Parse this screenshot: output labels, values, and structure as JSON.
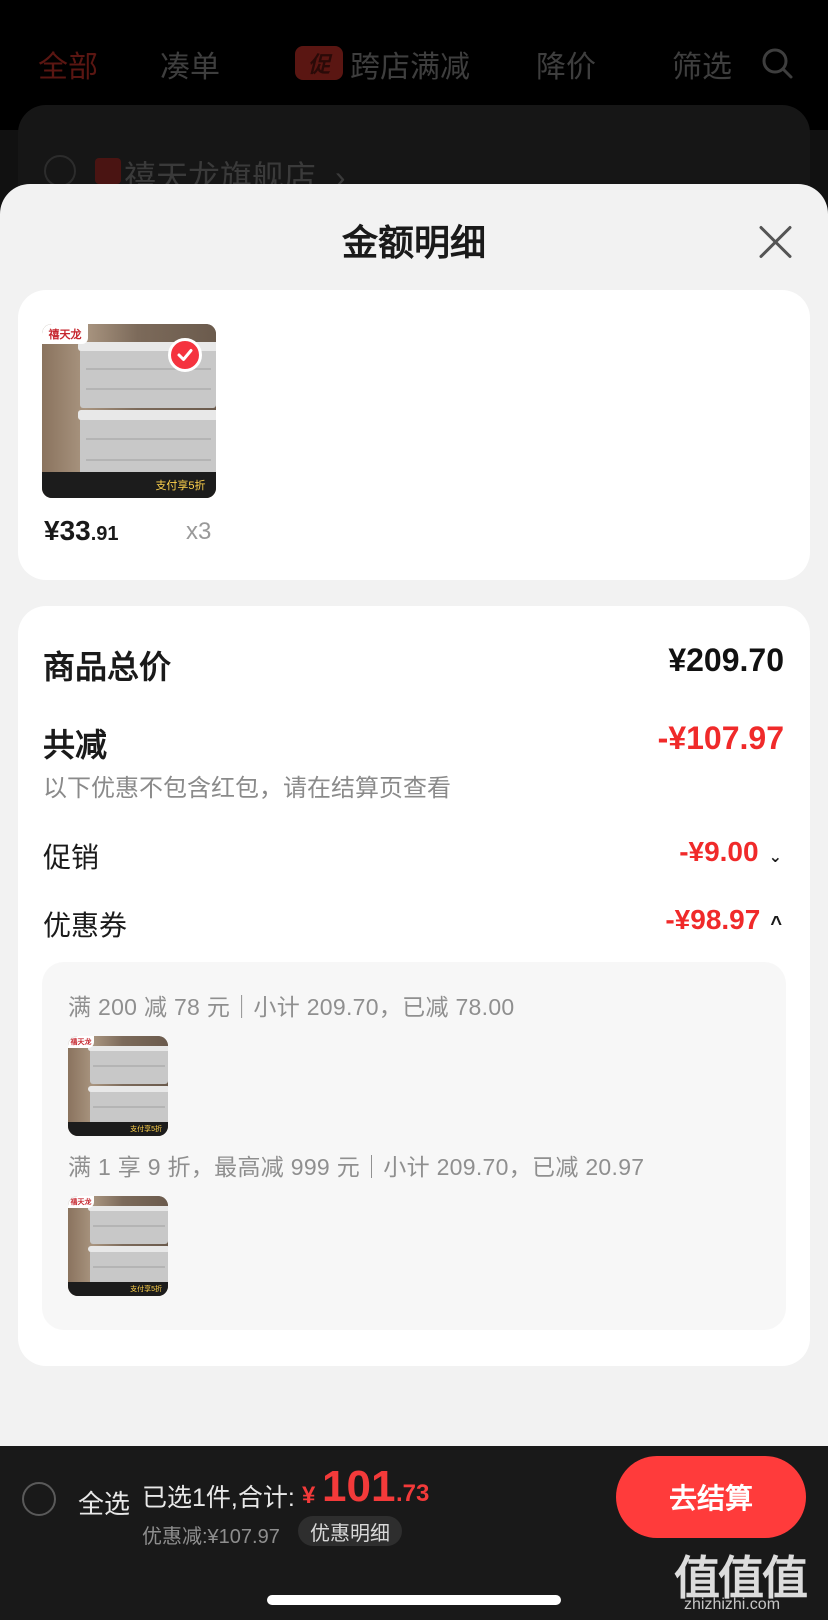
{
  "background": {
    "tabs": [
      {
        "label": "全部",
        "active": true
      },
      {
        "label": "凑单"
      },
      {
        "label": "跨店满减",
        "badge": "促"
      },
      {
        "label": "降价"
      },
      {
        "label": "筛选"
      }
    ],
    "store_name": "禧天龙旗舰店",
    "store_chevron": "›"
  },
  "sheet": {
    "title": "金额明细",
    "close_icon": "close-icon"
  },
  "product": {
    "brand_tag": "禧天龙",
    "strip_text": "支付享5折",
    "price_main": "¥33",
    "price_decimal": ".91",
    "quantity": "x3",
    "selected": true
  },
  "detail": {
    "total_label": "商品总价",
    "total_value": "¥209.70",
    "discount_label": "共减",
    "discount_value": "-¥107.97",
    "discount_note": "以下优惠不包含红包，请在结算页查看",
    "promo_label": "促销",
    "promo_value": "-¥9.00",
    "coupon_label": "优惠券",
    "coupon_value": "-¥98.97",
    "coupons": [
      {
        "text": "满 200 减 78 元｜小计 209.70，已减 78.00"
      },
      {
        "text": "满 1 享 9 折，最高减 999 元｜小计 209.70，已减 20.97"
      }
    ]
  },
  "bottom": {
    "select_all": "全选",
    "summary": "已选1件,合计:",
    "currency": "¥",
    "total_int": "101",
    "total_dec": ".73",
    "discount_text": "优惠减:¥107.97",
    "detail_pill": "优惠明细",
    "checkout": "去结算"
  },
  "watermark": {
    "logo": "值值值",
    "url": "zhizhizhi.com"
  },
  "colors": {
    "accent_red": "#f02a2a",
    "checkout_red": "#ff3b3b",
    "sheet_bg": "#f2f2f2"
  }
}
